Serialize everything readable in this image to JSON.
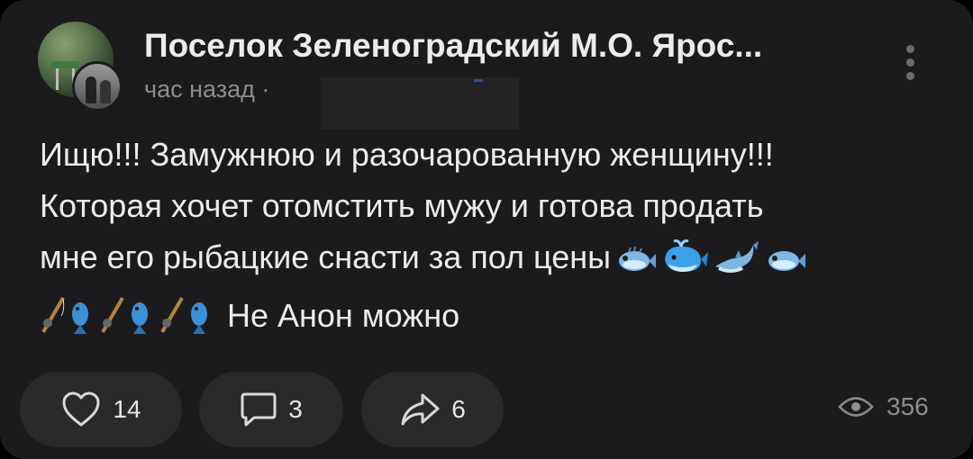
{
  "post": {
    "group_name": "Поселок Зеленоградский М.О. Ярос...",
    "time": "час назад ·",
    "body_lines": [
      "Ищю!!! Замужнюю и разочарованную женщину!!!",
      "Которая хочет отомстить мужу и готова продать",
      "мне его рыбацкие снасти за пол цены"
    ],
    "last_line_text": "Не Анон можно",
    "emojis_line3": [
      "blowfish-icon",
      "whale-icon",
      "dolphin-icon",
      "blowfish-icon"
    ],
    "emojis_line4": [
      "fishing-rod-icon",
      "fish-icon",
      "fishing-rod-icon",
      "fish-icon",
      "fishing-rod-icon",
      "fish-icon"
    ]
  },
  "actions": {
    "likes": "14",
    "comments": "3",
    "shares": "6",
    "views": "356"
  },
  "colors": {
    "background": "#1b1b1d",
    "pill": "#2a2a2c",
    "text": "#ececec",
    "muted": "#8d8d8f"
  }
}
